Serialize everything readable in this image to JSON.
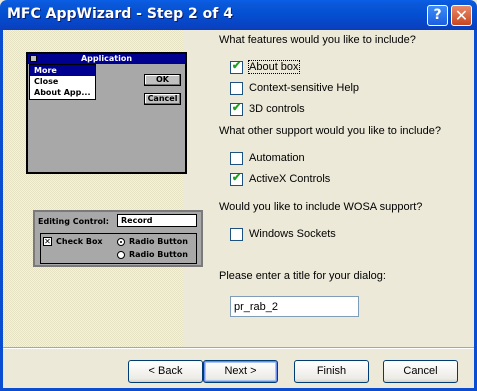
{
  "window": {
    "title": "MFC AppWizard - Step 2 of 4",
    "help_label": "?",
    "close_label": "✕"
  },
  "illustration": {
    "dialog_title": "Application",
    "menu_items": [
      "More",
      "Close",
      "About App..."
    ],
    "ok_label": "OK",
    "cancel_label": "Cancel",
    "editing_control_label": "Editing Control:",
    "editing_control_value": "Record",
    "checkbox_mark": "✕",
    "checkbox_label": "Check Box",
    "radio1_label": "Radio Button",
    "radio2_label": "Radio Button"
  },
  "features": {
    "question": "What features would you like to include?",
    "options": [
      {
        "label": "About box",
        "checked": true
      },
      {
        "label": "Context-sensitive Help",
        "checked": false
      },
      {
        "label": "3D controls",
        "checked": true
      }
    ]
  },
  "support": {
    "question": "What other support would you like to include?",
    "options": [
      {
        "label": "Automation",
        "checked": false
      },
      {
        "label": "ActiveX Controls",
        "checked": true
      }
    ]
  },
  "wosa": {
    "question": "Would you like to include WOSA support?",
    "options": [
      {
        "label": "Windows Sockets",
        "checked": false
      }
    ]
  },
  "dialog_title": {
    "prompt": "Please enter a title for your dialog:",
    "value": "pr_rab_2"
  },
  "buttons": {
    "back": "< Back",
    "next": "Next >",
    "finish": "Finish",
    "cancel": "Cancel"
  },
  "check_glyph": "✔"
}
